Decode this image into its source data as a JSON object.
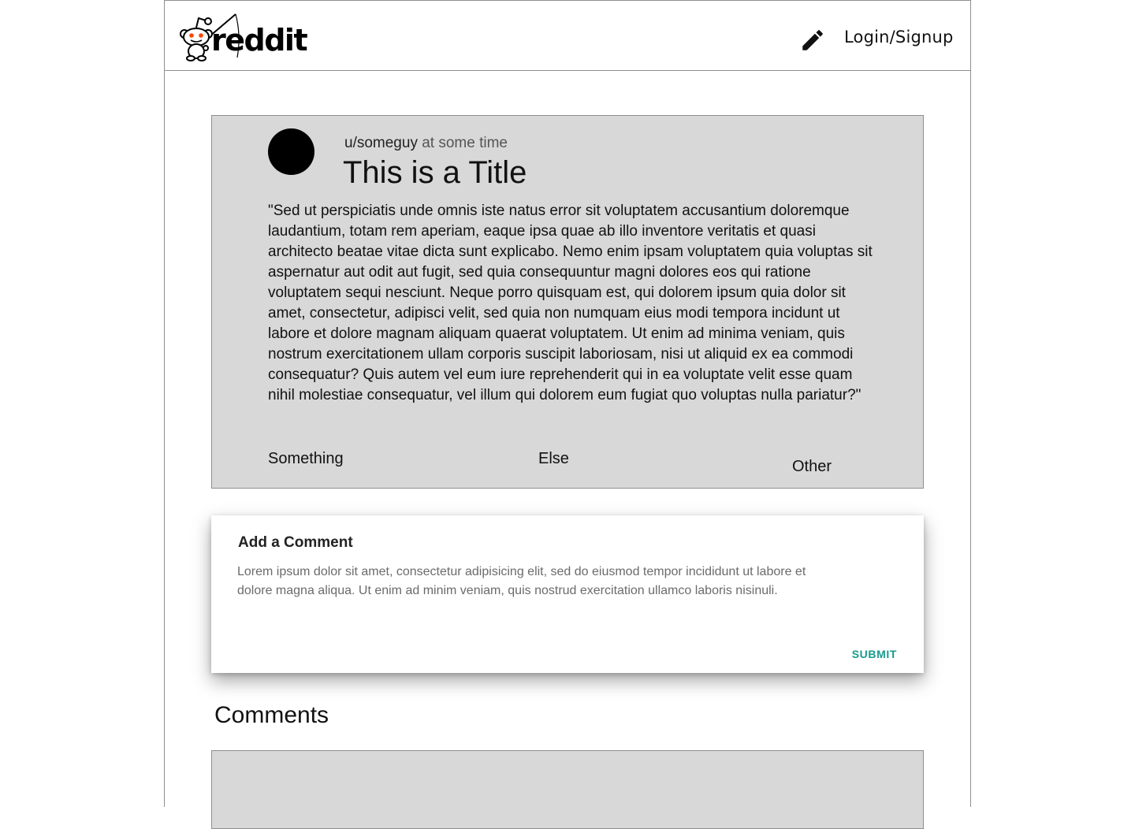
{
  "header": {
    "logo_text": "reddit",
    "login_label": "Login/Signup",
    "create_icon": "pencil-icon"
  },
  "post": {
    "author": "u/someguy",
    "time": "at some time",
    "title": "This is a Title",
    "body": "\"Sed ut perspiciatis unde omnis iste natus error sit voluptatem accusantium doloremque laudantium, totam rem aperiam, eaque ipsa quae ab illo inventore veritatis et quasi architecto beatae vitae dicta sunt explicabo. Nemo enim ipsam voluptatem quia voluptas sit aspernatur aut odit aut fugit, sed quia consequuntur magni dolores eos qui ratione voluptatem sequi nesciunt. Neque porro quisquam est, qui dolorem ipsum quia dolor sit amet, consectetur, adipisci velit, sed quia non numquam eius modi tempora incidunt ut labore et dolore magnam aliquam quaerat voluptatem. Ut enim ad minima veniam, quis nostrum exercitationem ullam corporis suscipit laboriosam, nisi ut aliquid ex ea commodi consequatur? Quis autem vel eum iure reprehenderit qui in ea voluptate velit esse quam nihil molestiae consequatur, vel illum qui dolorem eum fugiat quo voluptas nulla pariatur?\"",
    "actions": [
      "Something",
      "Else",
      "Other"
    ]
  },
  "comment_form": {
    "title": "Add a Comment",
    "text": "Lorem ipsum dolor sit amet, consectetur adipisicing elit, sed do eiusmod tempor incididunt ut labore et dolore magna aliqua. Ut enim ad minim veniam, quis nostrud exercitation ullamco laboris nisinuli.",
    "submit_label": "SUBMIT"
  },
  "comments": {
    "heading": "Comments"
  },
  "colors": {
    "card_gray": "#d8d8d8",
    "border_gray": "#8f8f8f",
    "accent_teal": "#169b8e"
  }
}
